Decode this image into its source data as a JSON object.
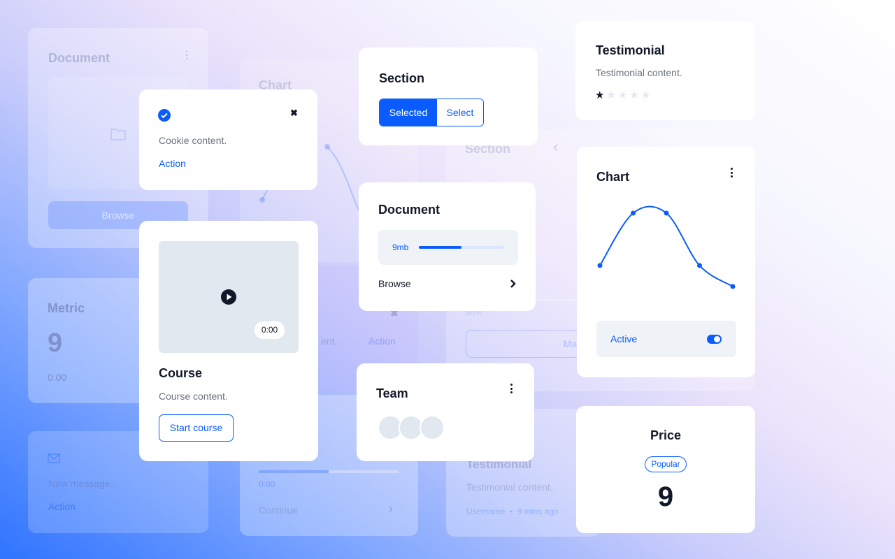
{
  "background": {
    "document": {
      "title": "Document",
      "button": "Browse",
      "icon": "folder-icon"
    },
    "chart": {
      "title": "Chart"
    },
    "cookie": {
      "content": "ent.",
      "action": "Action"
    },
    "player": {
      "time": "0:00",
      "progress": 0.5,
      "action": "Continue"
    },
    "metric": {
      "title": "Metric",
      "value": "9",
      "sub": "0.00"
    },
    "message": {
      "content": "New message.",
      "action": "Action",
      "icon": "mail-icon"
    },
    "section": {
      "title": "Section",
      "percent": "50%",
      "button": "Manage"
    },
    "testimonial": {
      "title": "Testimonial",
      "content": "Testimonial content.",
      "user": "Username",
      "time": "9 mins ago"
    }
  },
  "cookie": {
    "content": "Cookie content.",
    "action": "Action",
    "icon": "check-circle-icon"
  },
  "course": {
    "title": "Course",
    "content": "Course content.",
    "duration": "0:00",
    "button": "Start course"
  },
  "section": {
    "title": "Section",
    "options": [
      "Selected",
      "Select"
    ],
    "selected": 0
  },
  "document": {
    "title": "Document",
    "file_size": "9mb",
    "progress": 0.5,
    "browse": "Browse"
  },
  "team": {
    "title": "Team",
    "avatars": 3
  },
  "testimonial": {
    "title": "Testimonial",
    "content": "Testimonial content.",
    "rating": 1,
    "max_rating": 5
  },
  "chart_card": {
    "title": "Chart",
    "toggle_label": "Active",
    "toggle_on": true
  },
  "price": {
    "title": "Price",
    "badge": "Popular",
    "value": "9"
  },
  "colors": {
    "accent": "#0a5cff",
    "text": "#111827",
    "muted": "#6b7280",
    "surface": "#eff2f7"
  },
  "chart_data": {
    "type": "line",
    "x": [
      1,
      2,
      3,
      4,
      5
    ],
    "values": [
      4,
      9,
      9,
      4,
      2
    ],
    "title": "",
    "xlabel": "",
    "ylabel": "",
    "grid": false,
    "smooth": true
  }
}
